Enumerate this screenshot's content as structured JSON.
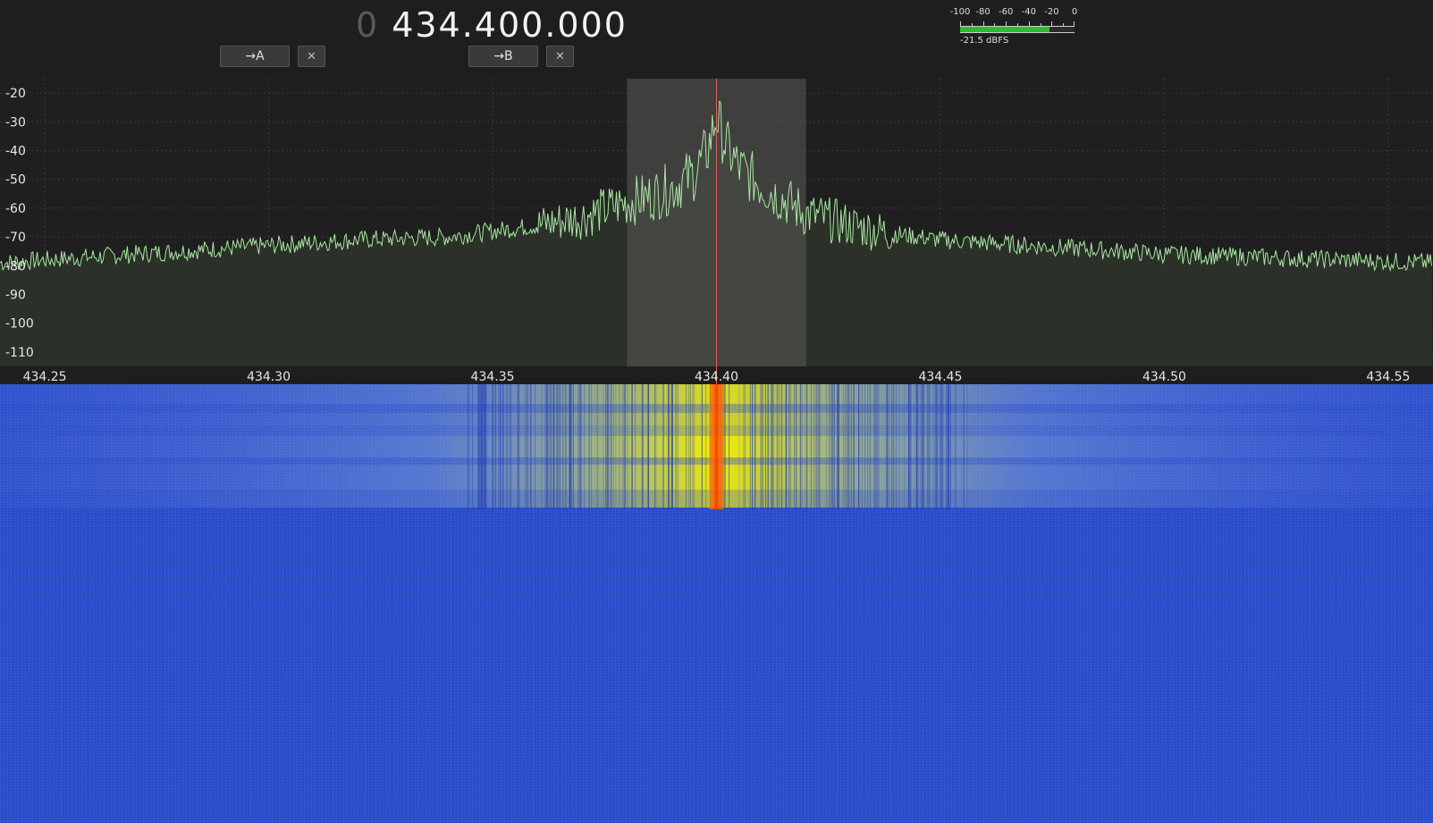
{
  "vfo": {
    "lead_digit": "0",
    "frequency": "434.400.000"
  },
  "buttons": {
    "to_a": "→A",
    "to_b": "→B",
    "clear": "✕"
  },
  "meter": {
    "ticks": [
      "-100",
      "-80",
      "-60",
      "-40",
      "-20",
      "0"
    ],
    "level_dbfs": -21.5,
    "readout": "-21.5 dBFS"
  },
  "chart_data": {
    "type": "line",
    "ylim": [
      -115,
      -15
    ],
    "xlim": [
      434.24,
      434.56
    ],
    "yticks": [
      "-20",
      "-30",
      "-40",
      "-50",
      "-60",
      "-70",
      "-80",
      "-90",
      "-100",
      "-110"
    ],
    "xticks": [
      "434.25",
      "434.30",
      "434.35",
      "434.40",
      "434.45",
      "434.50",
      "434.55"
    ],
    "center_mhz": 434.4,
    "passband_mhz": [
      434.38,
      434.42
    ],
    "grid": true,
    "series": [
      {
        "x": [
          434.24,
          434.26,
          434.28,
          434.3,
          434.32,
          434.34,
          434.35,
          434.36,
          434.37,
          434.38,
          434.385,
          434.39,
          434.395,
          434.398,
          434.4,
          434.402,
          434.405,
          434.41,
          434.415,
          434.42,
          434.43,
          434.44,
          434.45,
          434.46,
          434.48,
          434.5,
          434.52,
          434.54,
          434.56
        ],
        "y": [
          -79,
          -77,
          -75,
          -73,
          -71,
          -70,
          -68,
          -66,
          -63,
          -58,
          -56,
          -53,
          -48,
          -40,
          -28,
          -38,
          -46,
          -52,
          -57,
          -62,
          -66,
          -69,
          -71,
          -72,
          -74,
          -76,
          -77,
          -78,
          -79
        ]
      }
    ],
    "colors": {
      "trace": "#a8e6a0",
      "fill": "#2b3029",
      "center_line": "#e06060",
      "passband": "#5a5a58"
    }
  },
  "waterfall": {
    "base_color": "#2c4fd0",
    "signal_color": "#f5f000",
    "center_color": "#ff6a00"
  }
}
